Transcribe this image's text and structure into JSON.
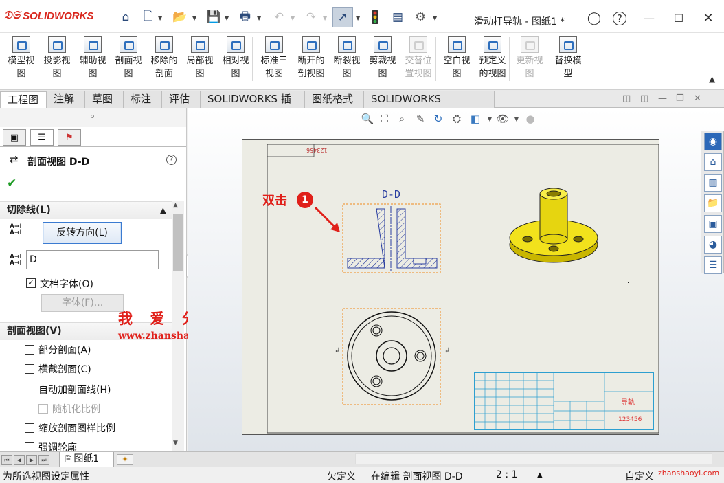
{
  "app": {
    "logo_text": "SOLIDWORKS",
    "doc_title": "滑动杆导轨 - 图纸1 *"
  },
  "quick_toolbar": {
    "icons": [
      "home-icon",
      "new-document-icon",
      "open-icon",
      "save-icon",
      "print-icon",
      "undo-icon",
      "redo-icon",
      "select-arrow-icon",
      "traffic-light-icon",
      "file-properties-icon",
      "gear-icon"
    ]
  },
  "ribbon": {
    "buttons": [
      {
        "line1": "模型视",
        "line2": "图",
        "enabled": true
      },
      {
        "line1": "投影视",
        "line2": "图",
        "enabled": true
      },
      {
        "line1": "辅助视",
        "line2": "图",
        "enabled": true
      },
      {
        "line1": "剖面视",
        "line2": "图",
        "enabled": true
      },
      {
        "line1": "移除的",
        "line2": "剖面",
        "enabled": true
      },
      {
        "line1": "局部视",
        "line2": "图",
        "enabled": true
      },
      {
        "line1": "相对视",
        "line2": "图",
        "enabled": true
      },
      {
        "line1": "标准三",
        "line2": "视图",
        "enabled": true
      },
      {
        "line1": "断开的",
        "line2": "剖视图",
        "enabled": true
      },
      {
        "line1": "断裂视",
        "line2": "图",
        "enabled": true
      },
      {
        "line1": "剪裁视",
        "line2": "图",
        "enabled": true
      },
      {
        "line1": "交替位",
        "line2": "置视图",
        "enabled": false
      },
      {
        "line1": "空白视",
        "line2": "图",
        "enabled": true
      },
      {
        "line1": "预定义",
        "line2": "的视图",
        "enabled": true
      },
      {
        "line1": "更新视",
        "line2": "图",
        "enabled": false
      },
      {
        "line1": "替换模",
        "line2": "型",
        "enabled": true
      }
    ]
  },
  "tabs": [
    "工程图",
    "注解",
    "草图",
    "标注",
    "评估",
    "SOLIDWORKS 插件",
    "图纸格式",
    "SOLIDWORKS Inspection"
  ],
  "active_tab": "工程图",
  "property_manager": {
    "title": "剖面视图 D-D",
    "help": "?",
    "cutline_group": "切除线(L)",
    "flip_button": "反转方向(L)",
    "label_value": "D",
    "doc_font_label": "文档字体(O)",
    "doc_font_checked": true,
    "font_button": "字体(F)...",
    "section_group": "剖面视图(V)",
    "options": [
      {
        "label": "部分剖面(A)",
        "checked": false,
        "enabled": true
      },
      {
        "label": "横截剖面(C)",
        "checked": false,
        "enabled": true
      },
      {
        "label": "自动加剖面线(H)",
        "checked": false,
        "enabled": true
      },
      {
        "label": "随机化比例",
        "checked": false,
        "enabled": false
      },
      {
        "label": "缩放剖面图样比例",
        "checked": false,
        "enabled": true
      },
      {
        "label": "强调轮廓",
        "checked": false,
        "enabled": true
      }
    ]
  },
  "watermark": {
    "title": "我 爱 分 享 网",
    "url": "www.zhanshaoyi.com",
    "url2": "zhanshaoyi.com"
  },
  "drawing": {
    "section_label": "D-D",
    "cut_mark": "D",
    "top_code": "123456",
    "title_block_name": "导轨",
    "title_block_code": "123456"
  },
  "annotation": {
    "callout_text": "双击",
    "badge": "1"
  },
  "sheet_tab": "图纸1",
  "status": {
    "hint": "为所选视图设定属性",
    "define": "欠定义",
    "editing": "在编辑 剖面视图 D-D",
    "scale": "2 : 1",
    "custom": "自定义"
  },
  "colors": {
    "accent": "#e0201a",
    "hatch": "#2a3ea0",
    "model_yellow": "#f2e21c",
    "sheet_bg": "#ecece4",
    "table_line": "#2d9fd0"
  }
}
